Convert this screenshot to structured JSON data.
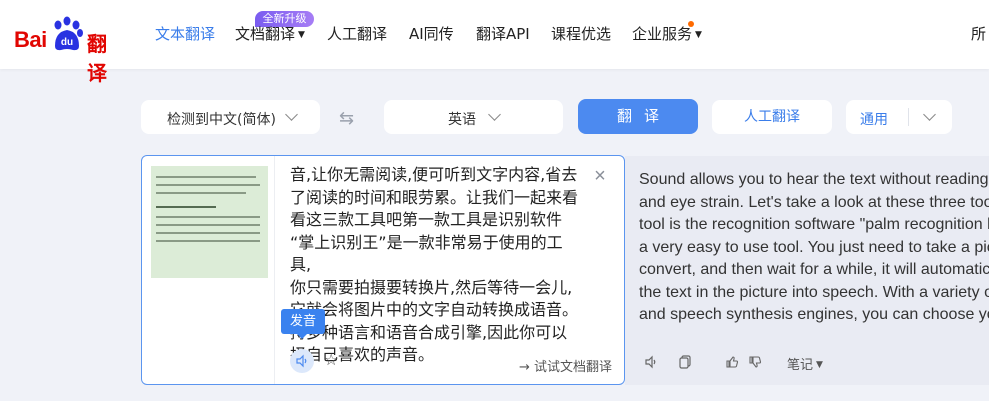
{
  "brand": {
    "logo_bai": "Bai",
    "logo_du": "du",
    "logo_fy": "翻译"
  },
  "nav": {
    "items": [
      {
        "label": "文本翻译"
      },
      {
        "label": "文档翻译"
      },
      {
        "label": "人工翻译"
      },
      {
        "label": "AI同传"
      },
      {
        "label": "翻译API"
      },
      {
        "label": "课程优选"
      },
      {
        "label": "企业服务"
      }
    ],
    "new_badge": "全新升级",
    "right_cut": "所"
  },
  "toolbar": {
    "source_lang": "检测到中文(简体)",
    "target_lang": "英语",
    "translate_label": "翻译",
    "human_translate_label": "人工翻译",
    "domain_label": "通用"
  },
  "source": {
    "lines": [
      "音,让你无需阅读,便可听到文字内容,省去",
      "了阅读的时间和眼劳累。让我们一起来看",
      "看这三款工具吧第一款工具是识别软件",
      "“掌上识别王”是一款非常易于使用的工具,",
      "你只需要拍摄要转换片,然后等待一会儿,",
      "它就会将图片中的文字自动转换成语音。",
      "持多种语言和语音合成引擎,因此你可以",
      "择自己喜欢的声音。"
    ],
    "speak_tooltip": "发音",
    "try_doc_label": "→ 试试文档翻译"
  },
  "target": {
    "lines": [
      "Sound allows you to hear the text without reading",
      "and eye strain. Let's take a look at these three too",
      "tool is the recognition software \"palm recognition k",
      "a very easy to use tool. You just need to take a pic",
      "convert, and then wait for a while, it will automatic",
      "the text in the picture into speech. With a variety o",
      "and speech synthesis engines, you can choose yo"
    ],
    "notes_label": "笔记"
  },
  "colors": {
    "accent": "#4c8af0",
    "brand_red": "#e10602",
    "badge_purple": "#8b6af3"
  }
}
